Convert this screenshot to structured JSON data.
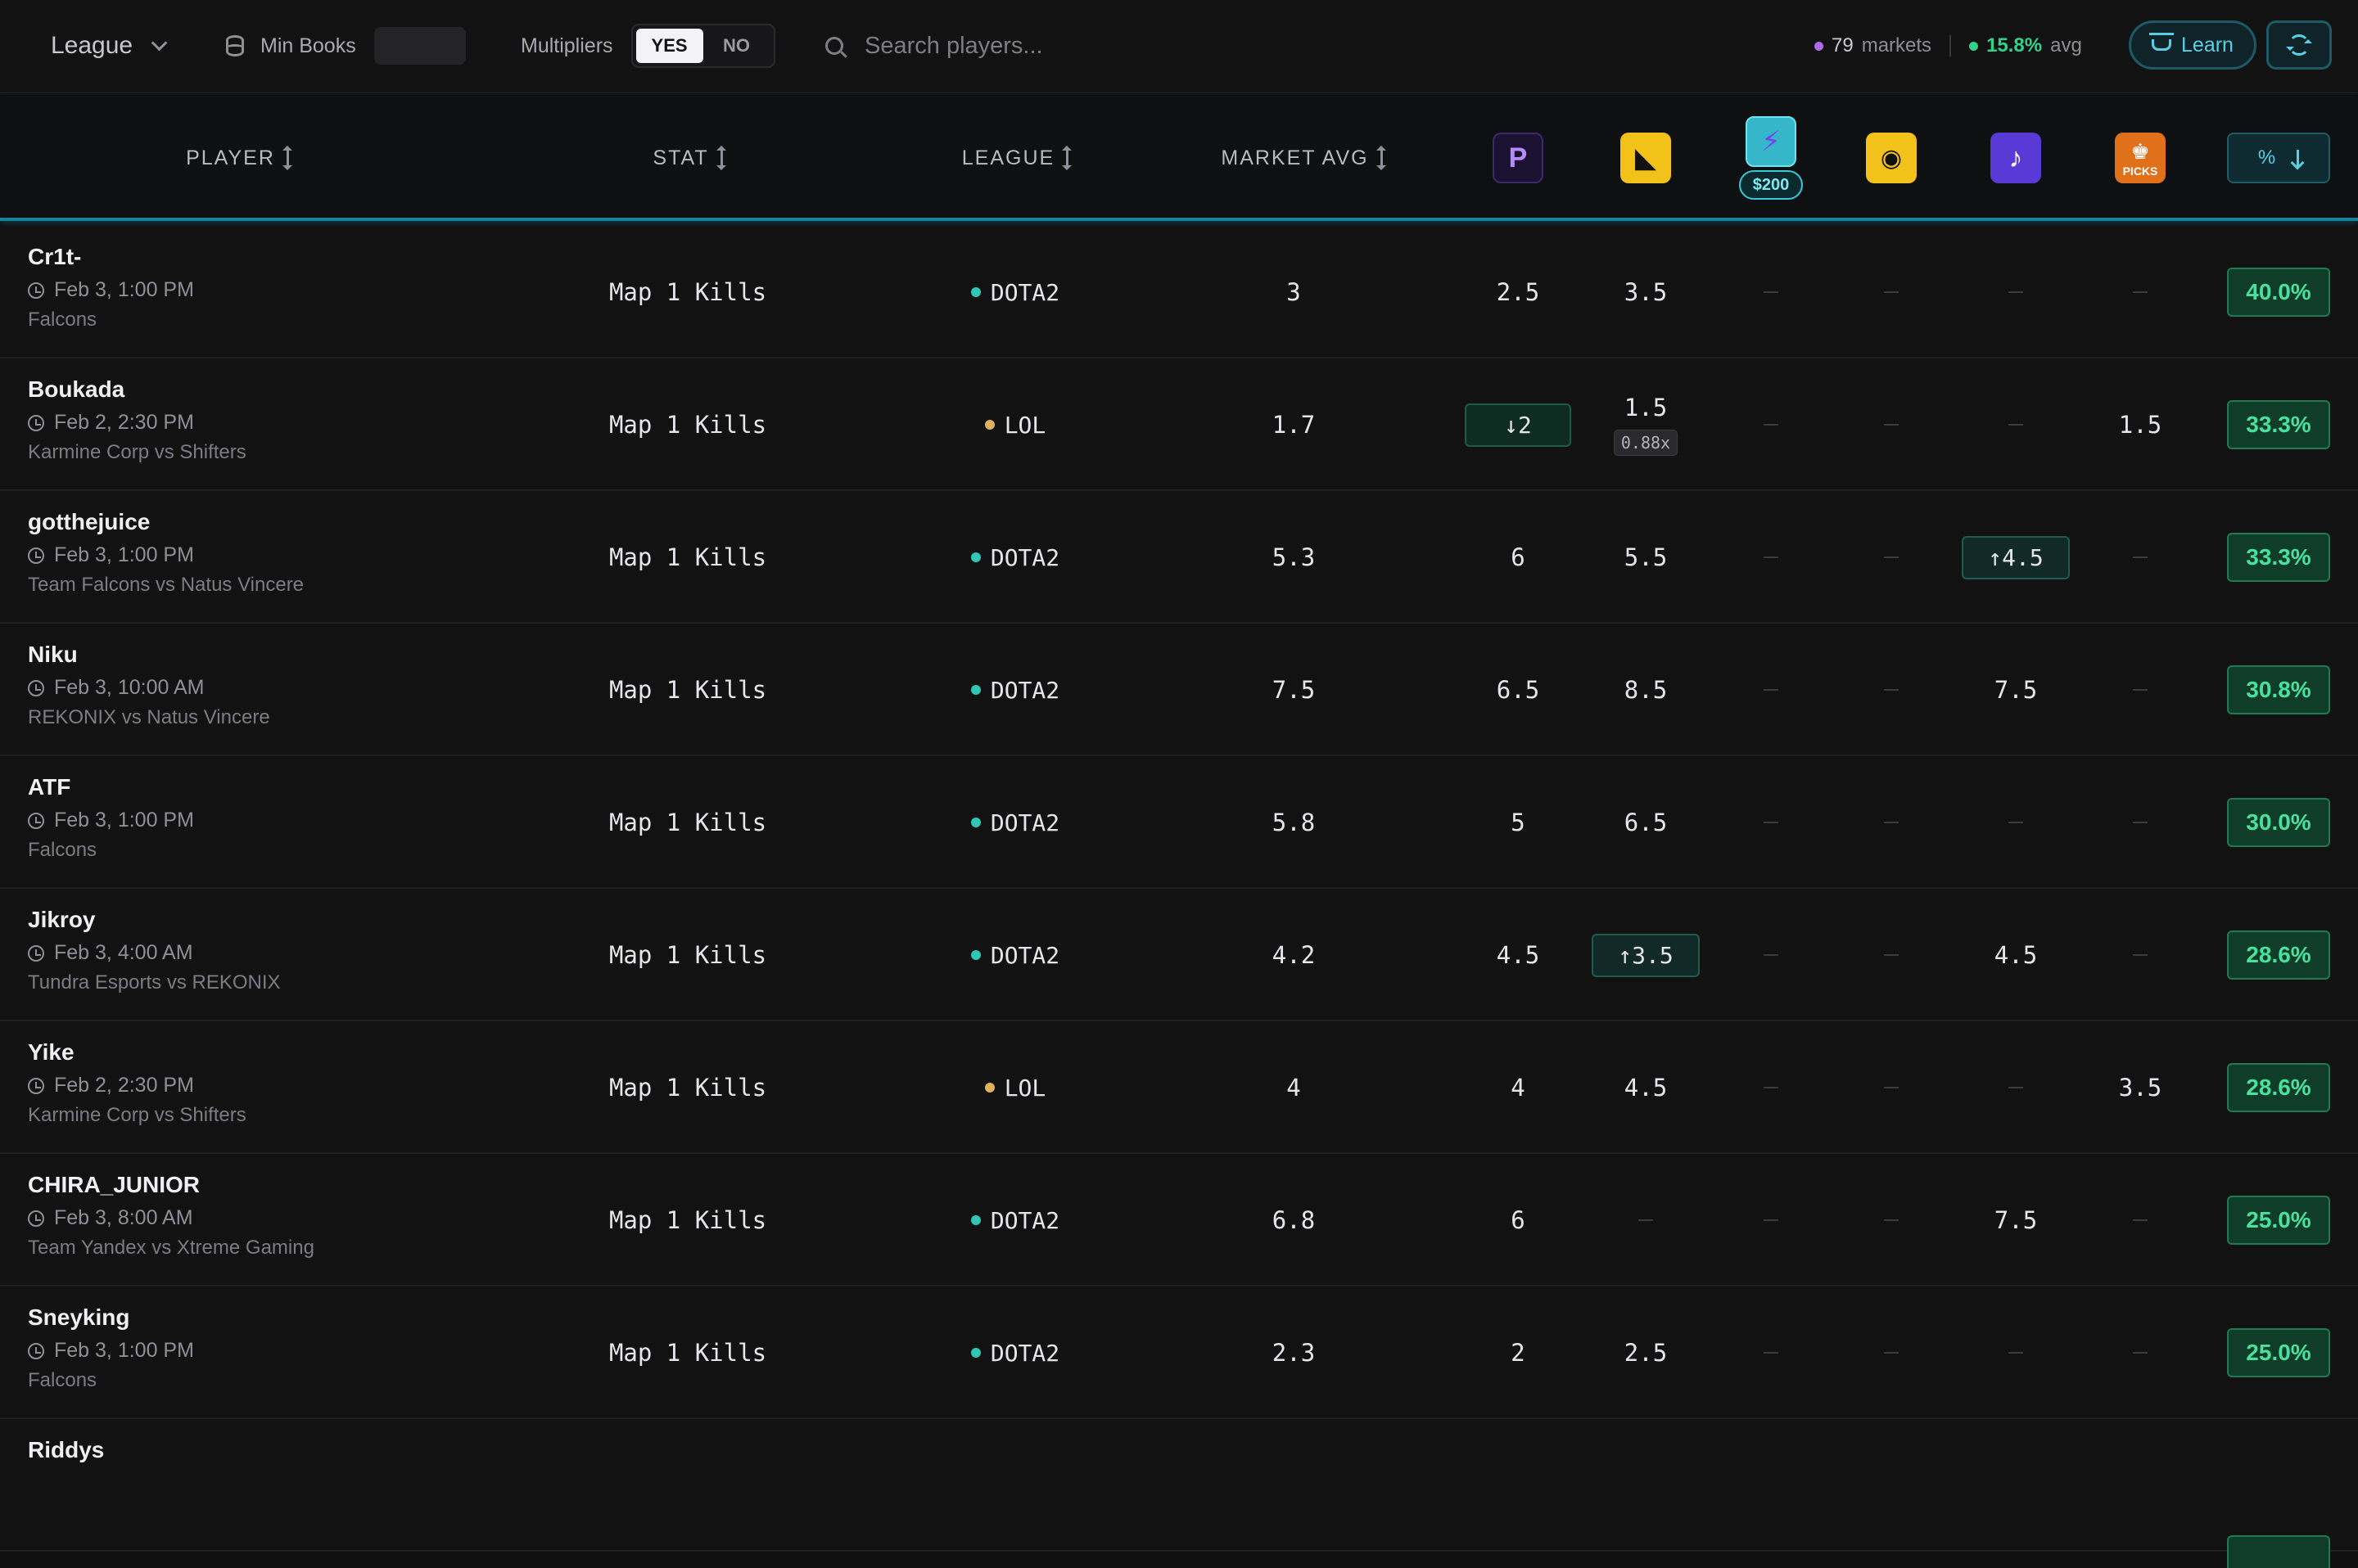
{
  "topbar": {
    "league_label": "League",
    "min_books_label": "Min Books",
    "multipliers_label": "Multipliers",
    "toggle_yes": "YES",
    "toggle_no": "NO",
    "search_placeholder": "Search players...",
    "markets_count": "79",
    "markets_label": "markets",
    "avg_value": "15.8%",
    "avg_label": "avg",
    "learn_label": "Learn"
  },
  "colors": {
    "accent": "#14829b",
    "positive": "#2fd38a",
    "dota_dot": "#2fc7b5",
    "lol_dot": "#e0b25a",
    "markets_dot": "#b06ae8"
  },
  "columns": {
    "player": "PLAYER",
    "stat": "STAT",
    "league": "LEAGUE",
    "market_avg": "MARKET AVG",
    "pct": "%",
    "books": [
      "prizepicks-icon",
      "underdog-icon",
      "dabble-icon",
      "sleeper-icon",
      "betr-icon",
      "draftkings-pick6-icon"
    ],
    "bonus_badge": "$200",
    "pick6_logo_text": "PICKS"
  },
  "rows": [
    {
      "name": "Cr1t-",
      "time": "Feb 3, 1:00 PM",
      "match": "Falcons",
      "stat": "Map 1 Kills",
      "league": "DOTA2",
      "avg": "3",
      "b": [
        "2.5",
        "3.5",
        "",
        "",
        "",
        ""
      ],
      "pct": "40.0%"
    },
    {
      "name": "Boukada",
      "time": "Feb 2, 2:30 PM",
      "match": "Karmine Corp vs Shifters",
      "stat": "Map 1 Kills",
      "league": "LOL",
      "avg": "1.7",
      "b": [
        "↓2",
        "1.5",
        "",
        "",
        "",
        "1.5"
      ],
      "b2_mult": "0.88x",
      "pct": "33.3%"
    },
    {
      "name": "gotthejuice",
      "time": "Feb 3, 1:00 PM",
      "match": "Team Falcons vs Natus Vincere",
      "stat": "Map 1 Kills",
      "league": "DOTA2",
      "avg": "5.3",
      "b": [
        "6",
        "5.5",
        "",
        "",
        "↑4.5",
        ""
      ],
      "pct": "33.3%"
    },
    {
      "name": "Niku",
      "time": "Feb 3, 10:00 AM",
      "match": "REKONIX vs Natus Vincere",
      "stat": "Map 1 Kills",
      "league": "DOTA2",
      "avg": "7.5",
      "b": [
        "6.5",
        "8.5",
        "",
        "",
        "7.5",
        ""
      ],
      "pct": "30.8%"
    },
    {
      "name": "ATF",
      "time": "Feb 3, 1:00 PM",
      "match": "Falcons",
      "stat": "Map 1 Kills",
      "league": "DOTA2",
      "avg": "5.8",
      "b": [
        "5",
        "6.5",
        "",
        "",
        "",
        ""
      ],
      "pct": "30.0%"
    },
    {
      "name": "Jikroy",
      "time": "Feb 3, 4:00 AM",
      "match": "Tundra Esports vs REKONIX",
      "stat": "Map 1 Kills",
      "league": "DOTA2",
      "avg": "4.2",
      "b": [
        "4.5",
        "↑3.5",
        "",
        "",
        "4.5",
        ""
      ],
      "pct": "28.6%"
    },
    {
      "name": "Yike",
      "time": "Feb 2, 2:30 PM",
      "match": "Karmine Corp vs Shifters",
      "stat": "Map 1 Kills",
      "league": "LOL",
      "avg": "4",
      "b": [
        "4",
        "4.5",
        "",
        "",
        "",
        "3.5"
      ],
      "pct": "28.6%"
    },
    {
      "name": "CHIRA_JUNIOR",
      "time": "Feb 3, 8:00 AM",
      "match": "Team Yandex vs Xtreme Gaming",
      "stat": "Map 1 Kills",
      "league": "DOTA2",
      "avg": "6.8",
      "b": [
        "6",
        "",
        "",
        "",
        "7.5",
        ""
      ],
      "pct": "25.0%"
    },
    {
      "name": "Sneyking",
      "time": "Feb 3, 1:00 PM",
      "match": "Falcons",
      "stat": "Map 1 Kills",
      "league": "DOTA2",
      "avg": "2.3",
      "b": [
        "2",
        "2.5",
        "",
        "",
        "",
        ""
      ],
      "pct": "25.0%"
    },
    {
      "name": "Riddys",
      "time": "",
      "match": "",
      "stat": "",
      "league": "",
      "avg": "",
      "b": [
        "",
        "",
        "",
        "",
        "",
        ""
      ],
      "pct": ""
    }
  ]
}
